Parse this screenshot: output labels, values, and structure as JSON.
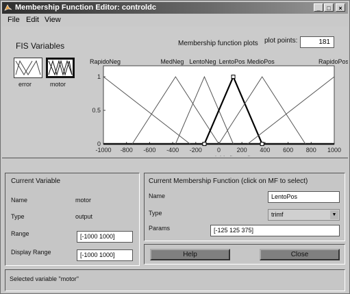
{
  "window": {
    "title": "Membership Function Editor: controldc"
  },
  "menu": [
    "File",
    "Edit",
    "View"
  ],
  "fis_variables": {
    "label": "FIS Variables",
    "inputs": [
      "error"
    ],
    "outputs": [
      "motor"
    ],
    "selected": "motor"
  },
  "plot": {
    "header": "Membership function plots",
    "plot_points_label": "plot points:",
    "plot_points": "181",
    "xlabel": "output variable \"motor\"",
    "x_ticks": [
      "-1000",
      "-800",
      "-600",
      "-400",
      "-200",
      "0",
      "200",
      "400",
      "600",
      "800",
      "1000"
    ],
    "y_ticks": [
      "0",
      "0.5",
      "1"
    ],
    "mf_labels": [
      "RapidoNeg",
      "MedNeg",
      "LentoNeg",
      "LentoPos",
      "MedioPos",
      "RapidoPos"
    ]
  },
  "chart_data": {
    "type": "line",
    "xlim": [
      -1000,
      1000
    ],
    "ylim": [
      0,
      1
    ],
    "xlabel": "output variable \"motor\"",
    "series": [
      {
        "name": "RapidoNeg",
        "points": [
          [
            -1000,
            1
          ],
          [
            -250,
            0
          ]
        ]
      },
      {
        "name": "MedNeg",
        "points": [
          [
            -750,
            0
          ],
          [
            -375,
            1
          ],
          [
            0,
            0
          ]
        ]
      },
      {
        "name": "LentoNeg",
        "points": [
          [
            -375,
            0
          ],
          [
            -125,
            1
          ],
          [
            125,
            0
          ]
        ]
      },
      {
        "name": "LentoPos",
        "points": [
          [
            -125,
            0
          ],
          [
            125,
            1
          ],
          [
            375,
            0
          ]
        ],
        "selected": true
      },
      {
        "name": "MedioPos",
        "points": [
          [
            0,
            0
          ],
          [
            375,
            1
          ],
          [
            750,
            0
          ]
        ]
      },
      {
        "name": "RapidoPos",
        "points": [
          [
            250,
            0
          ],
          [
            1000,
            1
          ]
        ]
      }
    ]
  },
  "current_variable": {
    "title": "Current Variable",
    "name_label": "Name",
    "name": "motor",
    "type_label": "Type",
    "type": "output",
    "range_label": "Range",
    "range": "[-1000 1000]",
    "display_range_label": "Display Range",
    "display_range": "[-1000 1000]"
  },
  "current_mf": {
    "title": "Current Membership Function (click on MF to select)",
    "name_label": "Name",
    "name": "LentoPos",
    "type_label": "Type",
    "type": "trimf",
    "params_label": "Params",
    "params": "[-125 125 375]"
  },
  "buttons": {
    "help": "Help",
    "close": "Close"
  },
  "status": "Selected variable \"motor\""
}
